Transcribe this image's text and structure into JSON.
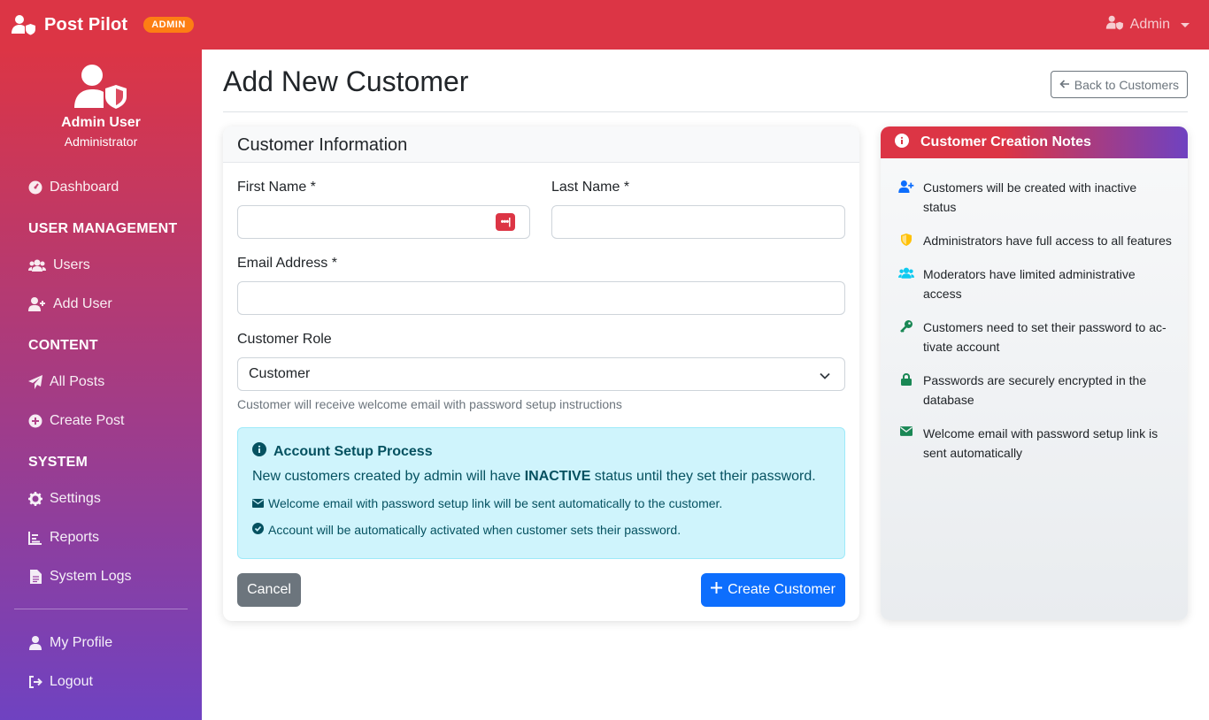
{
  "navbar": {
    "brand": "Post Pilot",
    "badge": "ADMIN",
    "user": "Admin"
  },
  "sidebar": {
    "user_name": "Admin User",
    "user_role": "Administrator",
    "items": [
      {
        "label": "Dashboard"
      },
      {
        "label": "Users"
      },
      {
        "label": "Add User"
      },
      {
        "label": "All Posts"
      },
      {
        "label": "Create Post"
      },
      {
        "label": "Settings"
      },
      {
        "label": "Reports"
      },
      {
        "label": "System Logs"
      },
      {
        "label": "My Profile"
      },
      {
        "label": "Logout"
      }
    ],
    "sections": [
      "USER MANAGEMENT",
      "CONTENT",
      "SYSTEM"
    ]
  },
  "page": {
    "title": "Add New Customer",
    "back_button": "Back to Customers"
  },
  "form": {
    "card_title": "Customer Information",
    "first_name_label": "First Name *",
    "first_name_value": "",
    "last_name_label": "Last Name *",
    "last_name_value": "",
    "email_label": "Email Address *",
    "email_value": "",
    "role_label": "Customer Role",
    "role_selected": "Customer",
    "role_help": "Customer will receive welcome email with password setup instructions",
    "alert": {
      "title": "Account Setup Process",
      "text_before": "New customers created by admin will have ",
      "text_bold": "INACTIVE",
      "text_after": " status until they set their password.",
      "line1": "Welcome email with password setup link will be sent automatically to the customer.",
      "line2": "Account will be automatically activated when customer sets their password."
    },
    "cancel_label": "Cancel",
    "create_label": "Create Customer"
  },
  "notes": {
    "title": "Customer Creation Notes",
    "items": [
      {
        "icon": "user-plus-icon",
        "color": "#0d6efd",
        "text": "Customers will be created with inactive status"
      },
      {
        "icon": "shield-icon",
        "color": "#ffc107",
        "text": "Administrators have full access to all features"
      },
      {
        "icon": "users-icon",
        "color": "#0dcaf0",
        "text": "Moderators have limited administrative access"
      },
      {
        "icon": "key-icon",
        "color": "#198754",
        "text": "Customers need to set their password to ac-tivate account"
      },
      {
        "icon": "lock-icon",
        "color": "#198754",
        "text": "Passwords are securely encrypted in the database"
      },
      {
        "icon": "envelope-icon",
        "color": "#198754",
        "text": "Welcome email with password setup link is sent automatically"
      }
    ]
  },
  "colors": {
    "navbar": "#dc3545",
    "sidebar_top": "#dc3545",
    "sidebar_bottom": "#6f42c1",
    "primary": "#0d6efd",
    "secondary": "#6c757d",
    "alert_bg": "#cff4fc",
    "alert_text": "#055160"
  }
}
